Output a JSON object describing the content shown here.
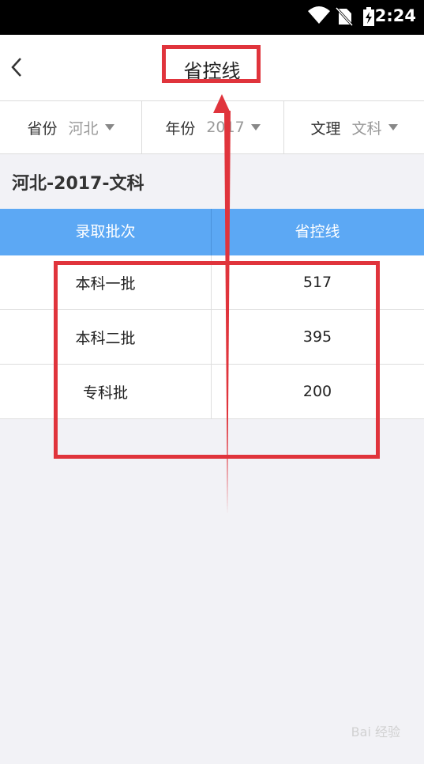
{
  "status": {
    "time": "2:24"
  },
  "nav": {
    "title": "省控线"
  },
  "filters": [
    {
      "label": "省份",
      "value": "河北"
    },
    {
      "label": "年份",
      "value": "2017"
    },
    {
      "label": "文理",
      "value": "文科"
    }
  ],
  "section_title": "河北-2017-文科",
  "table": {
    "headers": [
      "录取批次",
      "省控线"
    ],
    "rows": [
      {
        "batch": "本科一批",
        "line": "517"
      },
      {
        "batch": "本科二批",
        "line": "395"
      },
      {
        "batch": "专科批",
        "line": "200"
      }
    ]
  },
  "watermark": "Bai 经验"
}
